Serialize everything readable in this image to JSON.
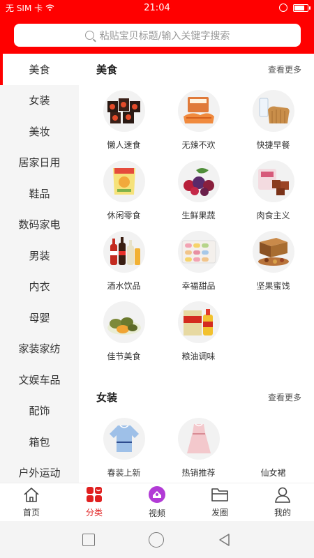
{
  "status": {
    "carrier": "无 SIM 卡",
    "time": "21:04",
    "battery_level": 0.9
  },
  "search": {
    "placeholder": "粘贴宝贝标题/输入关键字搜索"
  },
  "sidebar": {
    "items": [
      {
        "label": "美食"
      },
      {
        "label": "女装"
      },
      {
        "label": "美妆"
      },
      {
        "label": "居家日用"
      },
      {
        "label": "鞋品"
      },
      {
        "label": "数码家电"
      },
      {
        "label": "男装"
      },
      {
        "label": "内衣"
      },
      {
        "label": "母婴"
      },
      {
        "label": "家装家纺"
      },
      {
        "label": "文娱车品"
      },
      {
        "label": "配饰"
      },
      {
        "label": "箱包"
      },
      {
        "label": "户外运动"
      }
    ],
    "active": "美食"
  },
  "sections": [
    {
      "title": "美食",
      "more": "查看更多",
      "items": [
        {
          "label": "懒人速食",
          "icon": "instant-noodles"
        },
        {
          "label": "无辣不欢",
          "icon": "spicy-meat"
        },
        {
          "label": "快捷早餐",
          "icon": "bread-milk"
        },
        {
          "label": "休闲零食",
          "icon": "chips-bag"
        },
        {
          "label": "生鲜果蔬",
          "icon": "fresh-fruits"
        },
        {
          "label": "肉食主义",
          "icon": "braised-meat"
        },
        {
          "label": "酒水饮品",
          "icon": "drink-bottles"
        },
        {
          "label": "幸福甜品",
          "icon": "macarons"
        },
        {
          "label": "坚果蜜饯",
          "icon": "nuts-box"
        },
        {
          "label": "佳节美食",
          "icon": "egg-dumplings"
        },
        {
          "label": "粮油调味",
          "icon": "rice-oil"
        }
      ]
    },
    {
      "title": "女装",
      "more": "查看更多",
      "items": [
        {
          "label": "春装上新",
          "icon": "blue-blouse"
        },
        {
          "label": "热销推荐",
          "icon": "pink-dress"
        },
        {
          "label": "仙女裙",
          "icon": "skirt"
        }
      ]
    }
  ],
  "bottom_nav": [
    {
      "label": "首页",
      "icon": "home-icon"
    },
    {
      "label": "分类",
      "icon": "category-icon"
    },
    {
      "label": "视频",
      "icon": "video-icon"
    },
    {
      "label": "发圈",
      "icon": "folder-icon"
    },
    {
      "label": "我的",
      "icon": "user-icon"
    }
  ],
  "bottom_nav_active": "分类",
  "colors": {
    "brand": "#ff0000",
    "active_tab": "#e02020",
    "video_purple": "#b23bd6"
  }
}
